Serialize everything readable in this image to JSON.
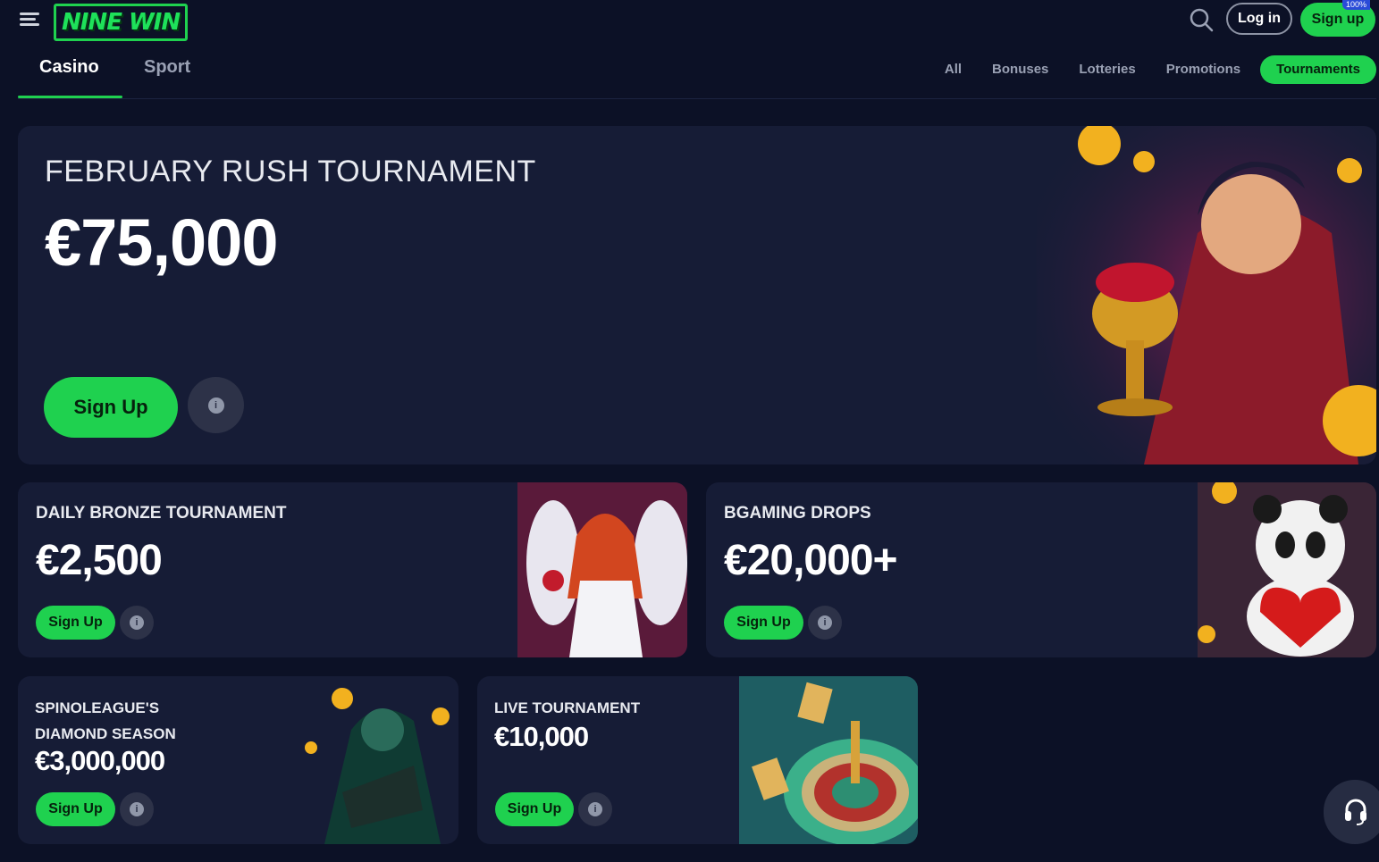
{
  "header": {
    "logo_text": "NINE WIN",
    "login_label": "Log in",
    "signup_label": "Sign up",
    "badge_text": "100%"
  },
  "tabs": {
    "main": [
      "Casino",
      "Sport"
    ],
    "active_main": "Casino",
    "filters": [
      "All",
      "Bonuses",
      "Lotteries",
      "Promotions",
      "Tournaments"
    ],
    "active_filter": "Tournaments"
  },
  "tournaments": [
    {
      "title": "FEBRUARY RUSH TOURNAMENT",
      "amount": "€75,000",
      "button": "Sign Up"
    },
    {
      "title": "DAILY BRONZE TOURNAMENT",
      "amount": "€2,500",
      "button": "Sign Up"
    },
    {
      "title": "BGAMING DROPS",
      "amount": "€20,000+",
      "button": "Sign Up"
    },
    {
      "title": "SPINOLEAGUE'S DIAMOND SEASON",
      "amount": "€3,000,000",
      "button": "Sign Up"
    },
    {
      "title": "LIVE TOURNAMENT",
      "amount": "€10,000",
      "button": "Sign Up"
    }
  ],
  "colors": {
    "accent": "#1fd14f",
    "background": "#0c1126",
    "card": "#161c36"
  },
  "icons": [
    "menu-icon",
    "search-icon",
    "info-icon",
    "headset-icon"
  ]
}
